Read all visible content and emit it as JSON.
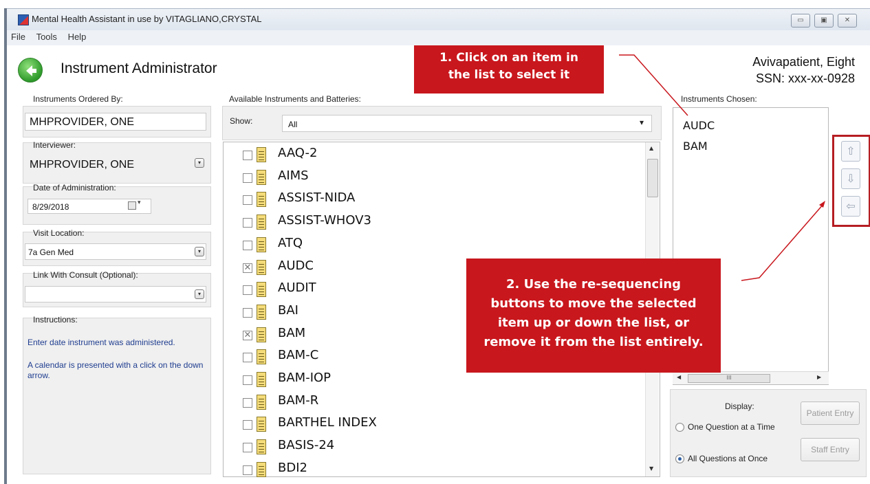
{
  "window": {
    "title": "Mental Health Assistant in use by VITAGLIANO,CRYSTAL",
    "menu": [
      "File",
      "Tools",
      "Help"
    ]
  },
  "header": {
    "title": "Instrument Administrator",
    "patient_name": "Avivapatient, Eight",
    "patient_ssn": "SSN: xxx-xx-0928"
  },
  "left": {
    "ordered_by_label": "Instruments Ordered By:",
    "ordered_by_value": "MHPROVIDER, ONE",
    "interviewer_label": "Interviewer:",
    "interviewer_value": "MHPROVIDER, ONE",
    "date_label": "Date of Administration:",
    "date_value": "8/29/2018",
    "visit_label": "Visit Location:",
    "visit_value": "7a Gen Med",
    "consult_label": "Link With Consult (Optional):",
    "consult_value": "",
    "instructions_label": "Instructions:",
    "instructions_line1": "Enter date instrument was administered.",
    "instructions_line2": "A calendar is presented with a click on the down arrow."
  },
  "middle": {
    "label": "Available Instruments and Batteries:",
    "show_label": "Show:",
    "show_value": "All",
    "instruments": [
      {
        "name": "AAQ-2",
        "checked": false
      },
      {
        "name": "AIMS",
        "checked": false
      },
      {
        "name": "ASSIST-NIDA",
        "checked": false
      },
      {
        "name": "ASSIST-WHOV3",
        "checked": false
      },
      {
        "name": "ATQ",
        "checked": false
      },
      {
        "name": "AUDC",
        "checked": true
      },
      {
        "name": "AUDIT",
        "checked": false
      },
      {
        "name": "BAI",
        "checked": false
      },
      {
        "name": "BAM",
        "checked": true
      },
      {
        "name": "BAM-C",
        "checked": false
      },
      {
        "name": "BAM-IOP",
        "checked": false
      },
      {
        "name": "BAM-R",
        "checked": false
      },
      {
        "name": "BARTHEL INDEX",
        "checked": false
      },
      {
        "name": "BASIS-24",
        "checked": false
      },
      {
        "name": "BDI2",
        "checked": false
      }
    ]
  },
  "right": {
    "chosen_label": "Instruments Chosen:",
    "chosen": [
      "AUDC",
      "BAM"
    ],
    "display_label": "Display:",
    "radio_one": "One Question at a Time",
    "radio_all": "All Questions at Once",
    "patient_entry": "Patient Entry",
    "staff_entry": "Staff Entry",
    "scroll_glyph": "III"
  },
  "callouts": {
    "c1_line1": "1. Click on an item in",
    "c1_line2": "the list to select it",
    "c2_line1": "2. Use the re-sequencing",
    "c2_line2": "buttons to move the selected",
    "c2_line3": "item up or down the list, or",
    "c2_line4": "remove it from the list entirely."
  },
  "colors": {
    "callout": "#c8171d",
    "instructions_text": "#1f3d8f"
  }
}
